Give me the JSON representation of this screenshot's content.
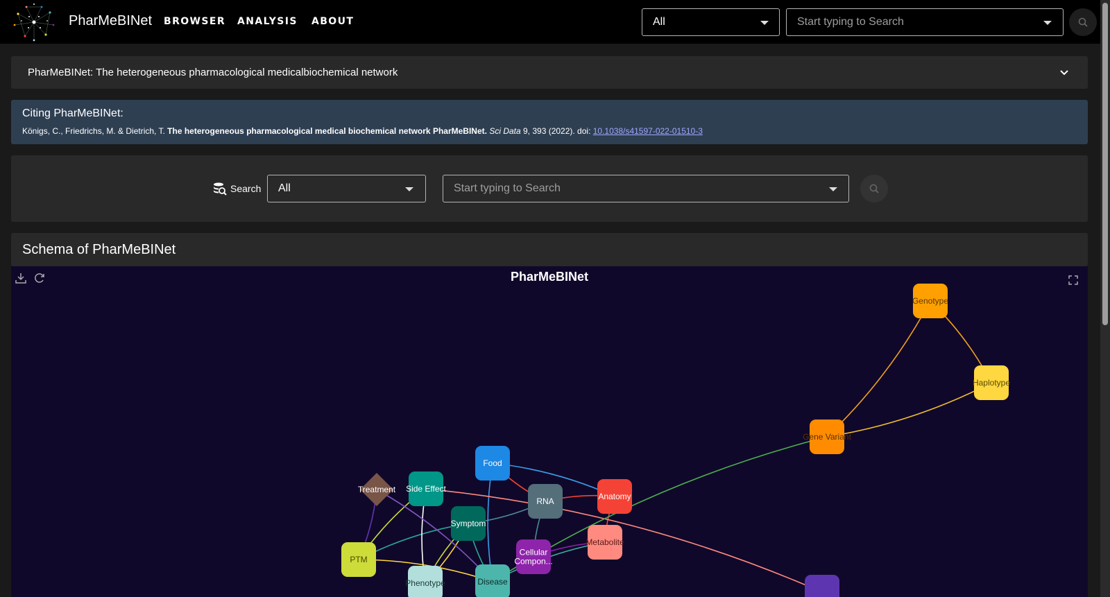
{
  "app": {
    "brand": "PharMeBINet",
    "nav": [
      "BROWSER",
      "ANALYSIS",
      "ABOUT"
    ],
    "top_search": {
      "category": "All",
      "placeholder": "Start typing to Search"
    }
  },
  "accordion": {
    "title": "PharMeBINet: The heterogeneous pharmacological medicalbiochemical network"
  },
  "citation": {
    "heading": "Citing PharMeBINet:",
    "authors": "Königs, C., Friedrichs, M. & Dietrich, T. ",
    "paper_title": "The heterogeneous pharmacological medical biochemical network PharMeBINet.",
    "journal": "Sci Data",
    "details": " 9, 393 (2022). doi: ",
    "doi": "10.1038/s41597-022-01510-3"
  },
  "search": {
    "label": "Search",
    "category": "All",
    "placeholder": "Start typing to Search"
  },
  "schema": {
    "heading": "Schema of PharMeBINet",
    "graph_title": "PharMeBINet"
  },
  "nodes": [
    {
      "label": "Genotype",
      "color": "#ffa000",
      "text": "#5a3a00"
    },
    {
      "label": "Haplotype",
      "color": "#ffd740",
      "text": "#5a4a00"
    },
    {
      "label": "Gene Variant",
      "color": "#ff8c00",
      "text": "#5a3000"
    },
    {
      "label": "Food",
      "color": "#1e88e5",
      "text": "#ffffff"
    },
    {
      "label": "Treatment",
      "color": "#795548",
      "text": "#ffffff"
    },
    {
      "label": "Side Effect",
      "color": "#009688",
      "text": "#ffffff"
    },
    {
      "label": "RNA",
      "color": "#546e7a",
      "text": "#ffffff"
    },
    {
      "label": "Anatomy",
      "color": "#f44336",
      "text": "#ffffff"
    },
    {
      "label": "Symptom",
      "color": "#00695c",
      "text": "#ffffff"
    },
    {
      "label": "Metabolite",
      "color": "#ff8a80",
      "text": "#5a1a1a"
    },
    {
      "label": "PTM",
      "color": "#cddc39",
      "text": "#4a4a00"
    },
    {
      "label": "Cellular Compon...",
      "color": "#8e24aa",
      "text": "#ffffff"
    },
    {
      "label": "Phenotype",
      "color": "#b2dfdb",
      "text": "#1a3a3a"
    },
    {
      "label": "Disease",
      "color": "#4db6ac",
      "text": "#0d2a2a"
    },
    {
      "label": "",
      "color": "#5e35b1",
      "text": "#ffffff"
    }
  ]
}
